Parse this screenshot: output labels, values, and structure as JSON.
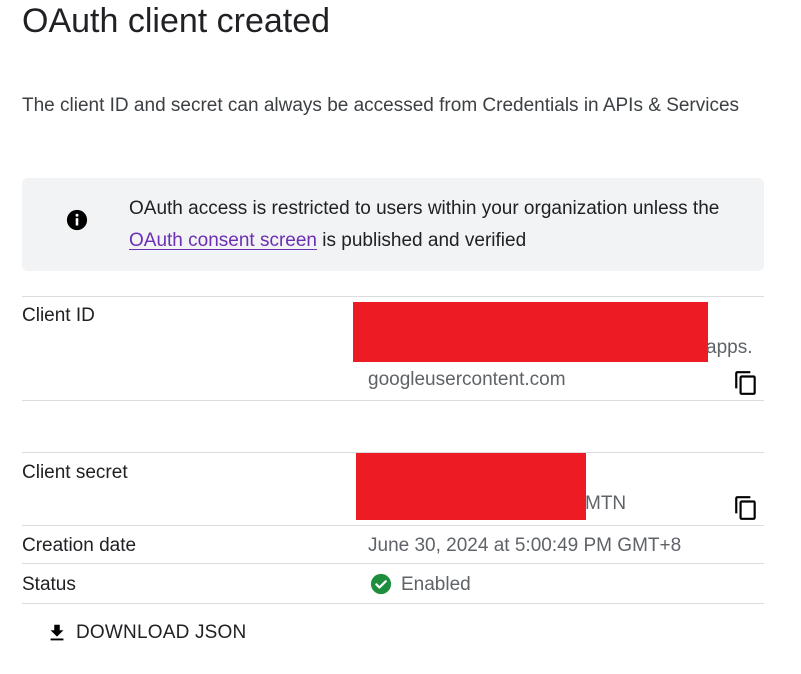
{
  "page": {
    "title": "OAuth client created",
    "description": "The client ID and secret can always be accessed from Credentials in APIs & Services"
  },
  "info_banner": {
    "icon": "info-icon",
    "text_before": "OAuth access is restricted to users within your organization unless the ",
    "link_text": "OAuth consent screen",
    "text_after": " is published and verified",
    "link_color": "#6b2fb3"
  },
  "details": {
    "client_id": {
      "label": "Client ID",
      "value_suffix_line1": "apps.",
      "value_line2": "googleusercontent.com",
      "copy_icon": "copy-icon"
    },
    "client_secret": {
      "label": "Client secret",
      "value_suffix": "MTN",
      "copy_icon": "copy-icon"
    },
    "creation_date": {
      "label": "Creation date",
      "value": "June 30, 2024 at 5:00:49 PM GMT+8"
    },
    "status": {
      "label": "Status",
      "value": "Enabled",
      "icon": "check-circle-icon",
      "icon_color": "#1e8e3e"
    }
  },
  "actions": {
    "download_label": "DOWNLOAD JSON",
    "download_icon": "download-icon"
  },
  "colors": {
    "redaction": "#ed1c24",
    "banner_bg": "#f1f3f4",
    "divider": "#dadce0"
  }
}
